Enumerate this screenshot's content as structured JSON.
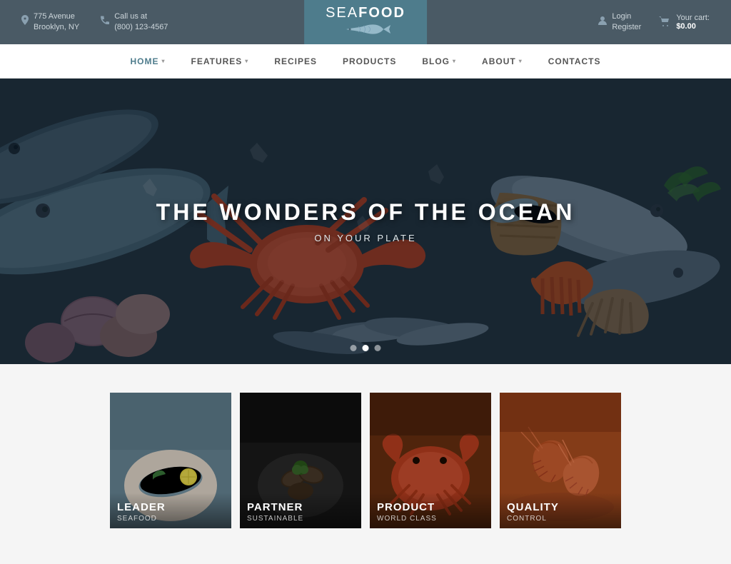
{
  "topbar": {
    "address_icon": "location-pin",
    "address_line1": "775 Avenue",
    "address_line2": "Brooklyn, NY",
    "phone_icon": "phone",
    "phone_label": "Call us at",
    "phone_number": "(800) 123-4567",
    "login_label": "Login",
    "register_label": "Register",
    "cart_label": "Your cart:",
    "cart_amount": "$0.00"
  },
  "logo": {
    "sea": "SEA",
    "food": "FOOD"
  },
  "nav": {
    "items": [
      {
        "label": "HOME",
        "active": true,
        "has_arrow": true
      },
      {
        "label": "FEATURES",
        "active": false,
        "has_arrow": true
      },
      {
        "label": "RECIPES",
        "active": false,
        "has_arrow": false
      },
      {
        "label": "PRODUCTS",
        "active": false,
        "has_arrow": false
      },
      {
        "label": "BLOG",
        "active": false,
        "has_arrow": true
      },
      {
        "label": "ABOUT",
        "active": false,
        "has_arrow": true
      },
      {
        "label": "CONTACTS",
        "active": false,
        "has_arrow": false
      }
    ]
  },
  "hero": {
    "title": "THE WONDERS OF THE OCEAN",
    "subtitle": "ON YOUR PLATE",
    "dots": [
      {
        "active": false
      },
      {
        "active": true
      },
      {
        "active": false
      }
    ]
  },
  "cards": [
    {
      "title": "LEADER",
      "subtitle": "Seafood",
      "bg_class": "card-1-bg"
    },
    {
      "title": "PARTNER",
      "subtitle": "Sustainable",
      "bg_class": "card-2-bg"
    },
    {
      "title": "PRODUCT",
      "subtitle": "World Class",
      "bg_class": "card-3-bg"
    },
    {
      "title": "QUALITY",
      "subtitle": "Control",
      "bg_class": "card-4-bg"
    }
  ]
}
